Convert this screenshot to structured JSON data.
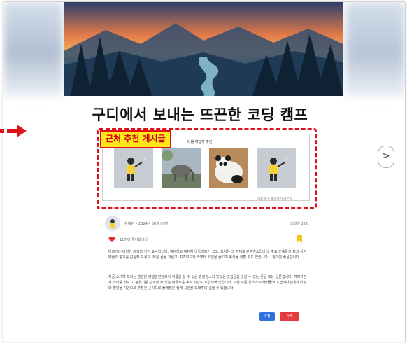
{
  "post": {
    "title": "구디에서 보내는 뜨끈한 코딩 캠프",
    "author": "김혜린",
    "date": "2024년 08월 09일",
    "views_label": "조회수",
    "views": "322",
    "likes_text": "11명이 좋아합니다",
    "paragraphs": [
      "미쁘에는 다양한 매력을 가진 도시입니다. 여담하고 평탄해서 돌려보기 쉽고, 도심은 그 자체로 관광명소입니다. 주요 건축물을 보고 서면 예술의 향기를 감상해 보세요. 작은 길을 거닐고, 치즈보드와 카망테 와인을 즐기며 휴식을 취할 수도 있습니다. 1월이면 좋은합니다.",
      "지금 소개해 드리는 명방은 여행관련정보의 작품을 볼 수 있는 관광명소와 맛있는 맛집들을 맛볼 수 있는 곳을 모는 입문입니다. 여여가면서 과리를 맛보고, 분위기를 만끽할 수 있는 여유로운 휴식 시간도 포함되어 있습니다. 또한 모든 장소가 여행자들의 드랩에다면에서 리뷰와 평점을 기반으로 추천된 곳이므로 플래팸은 썸에 시간을 보내주의 걸을 수 있습니다."
    ]
  },
  "recommendations": {
    "badge": "근처 추천 게시글",
    "header": "다음 여행지 추천",
    "footer": "이용 중구 둘러보기 모든 5",
    "items": [
      {
        "kind": "illustration"
      },
      {
        "kind": "elephant-photo"
      },
      {
        "kind": "panda-photo"
      },
      {
        "kind": "illustration"
      }
    ]
  },
  "nav": {
    "next_symbol": ">"
  },
  "buttons": {
    "edit": "수정",
    "delete": "삭제"
  },
  "colors": {
    "highlight_red": "#e0101a",
    "badge_yellow": "#ffe81a",
    "edit_blue": "#2f6fe0",
    "delete_red": "#e23b3b",
    "bookmark_yellow": "#f5c518"
  }
}
